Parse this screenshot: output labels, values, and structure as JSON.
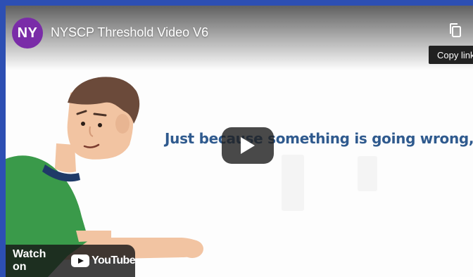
{
  "embed": {
    "channel_avatar_text": "NY",
    "title": "NYSCP Threshold Video V6",
    "copy_link_tooltip": "Copy link",
    "icons": {
      "copy": "copy-icon",
      "play": "play-icon",
      "youtube": "youtube-logo-icon"
    }
  },
  "video_frame": {
    "caption": "Just because something is going wrong,"
  },
  "watch_on": {
    "label": "Watch on",
    "brand": "YouTube"
  },
  "colors": {
    "page_bg": "#2d4fb3",
    "avatar": "#7a2ca8",
    "caption": "#2f5a8e",
    "youtube_red": "#ff0000",
    "shirt": "#3a9a4a",
    "hair": "#6b4a3a",
    "skin": "#f2c4a2"
  }
}
